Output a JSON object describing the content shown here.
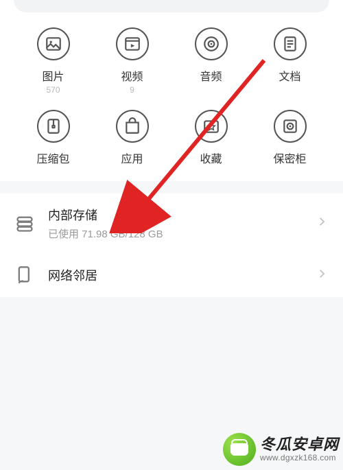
{
  "categories": {
    "items": [
      {
        "name": "image",
        "label": "图片",
        "count": "570"
      },
      {
        "name": "video",
        "label": "视频",
        "count": "9"
      },
      {
        "name": "audio",
        "label": "音频",
        "count": ""
      },
      {
        "name": "document",
        "label": "文档",
        "count": ""
      },
      {
        "name": "archive",
        "label": "压缩包",
        "count": ""
      },
      {
        "name": "app",
        "label": "应用",
        "count": ""
      },
      {
        "name": "favorite",
        "label": "收藏",
        "count": ""
      },
      {
        "name": "safe",
        "label": "保密柜",
        "count": ""
      }
    ]
  },
  "storage": {
    "internal": {
      "title": "内部存储",
      "sub": "已使用 71.98 GB/128 GB"
    },
    "network": {
      "title": "网络邻居"
    }
  },
  "annotation": {
    "color": "#e02424"
  },
  "watermark": {
    "title": "冬瓜安卓网",
    "url": "www.dgxzk168.com"
  }
}
